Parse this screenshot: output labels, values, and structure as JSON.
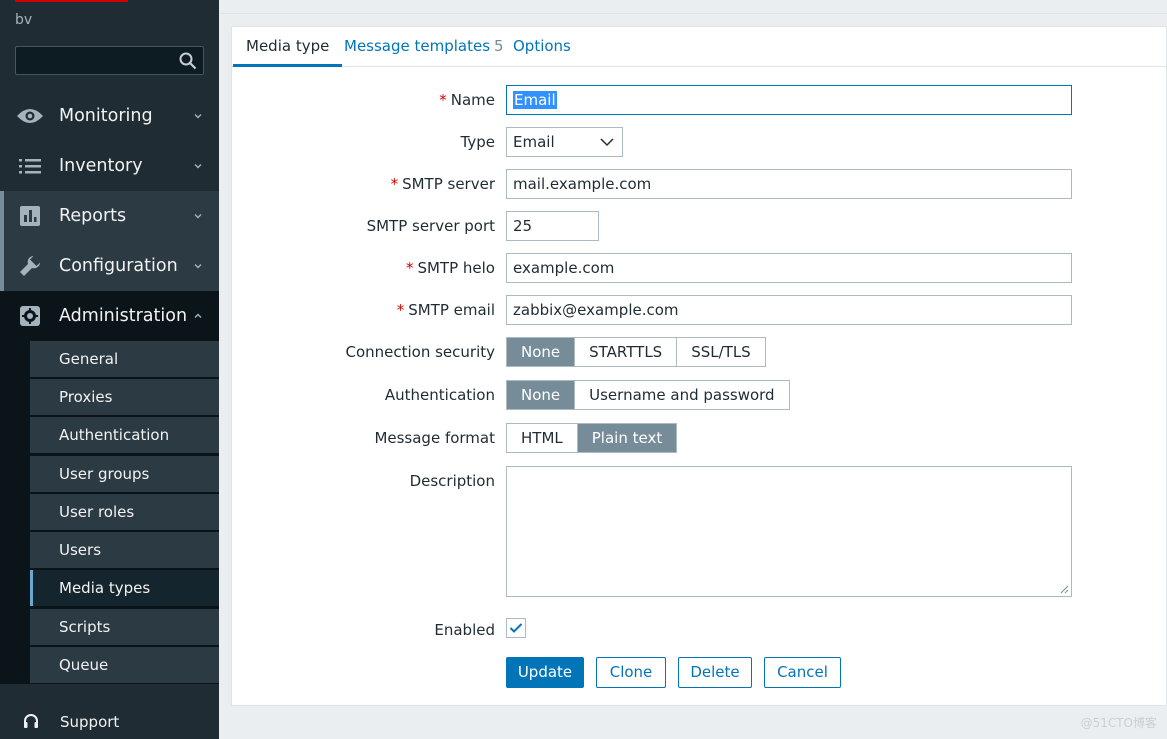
{
  "sidebar": {
    "logo_text": "bv",
    "search_placeholder": "",
    "menu": [
      {
        "label": "Monitoring",
        "icon": "eye-icon"
      },
      {
        "label": "Inventory",
        "icon": "list-icon"
      },
      {
        "label": "Reports",
        "icon": "bar-chart-icon"
      },
      {
        "label": "Configuration",
        "icon": "wrench-icon"
      },
      {
        "label": "Administration",
        "icon": "gear-icon"
      }
    ],
    "admin_items": [
      "General",
      "Proxies",
      "Authentication",
      "User groups",
      "User roles",
      "Users",
      "Media types",
      "Scripts",
      "Queue"
    ],
    "active_item": "Media types",
    "support_label": "Support"
  },
  "tabs": {
    "media_type": "Media type",
    "message_templates": "Message templates",
    "message_templates_count": "5",
    "options": "Options"
  },
  "form": {
    "name_label": "Name",
    "name_value": "Email",
    "type_label": "Type",
    "type_value": "Email",
    "smtp_server_label": "SMTP server",
    "smtp_server_value": "mail.example.com",
    "smtp_port_label": "SMTP server port",
    "smtp_port_value": "25",
    "smtp_helo_label": "SMTP helo",
    "smtp_helo_value": "example.com",
    "smtp_email_label": "SMTP email",
    "smtp_email_value": "zabbix@example.com",
    "connection_security_label": "Connection security",
    "connection_security_options": [
      "None",
      "STARTTLS",
      "SSL/TLS"
    ],
    "connection_security_selected": "None",
    "authentication_label": "Authentication",
    "authentication_options": [
      "None",
      "Username and password"
    ],
    "authentication_selected": "None",
    "message_format_label": "Message format",
    "message_format_options": [
      "HTML",
      "Plain text"
    ],
    "message_format_selected": "Plain text",
    "description_label": "Description",
    "description_value": "",
    "enabled_label": "Enabled",
    "enabled": true,
    "required_mark": "*"
  },
  "buttons": {
    "update": "Update",
    "clone": "Clone",
    "delete": "Delete",
    "cancel": "Cancel"
  },
  "watermark": "@51CTO博客",
  "colors": {
    "sidebar_bg": "#1f2c33",
    "accent": "#0275b8",
    "segment_on": "#768d99",
    "required": "#d40000"
  }
}
